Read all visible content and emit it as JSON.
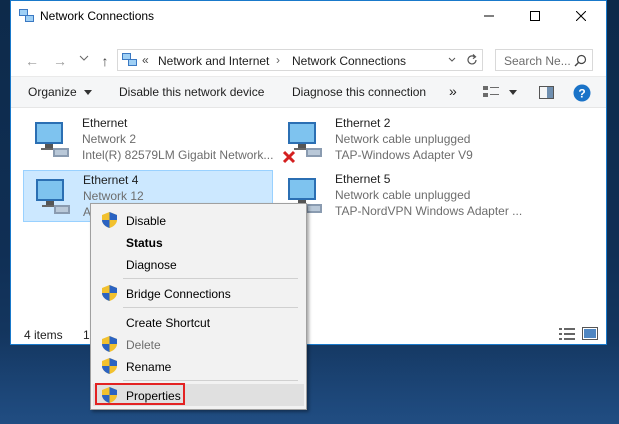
{
  "window": {
    "title": "Network Connections",
    "breadcrumb": [
      "Network and Internet",
      "Network Connections"
    ],
    "breadcrumb_prefix": "«",
    "search_placeholder": "Search Ne..."
  },
  "toolbar": {
    "organize": "Organize",
    "disable": "Disable this network device",
    "diagnose": "Diagnose this connection",
    "more": "»"
  },
  "adapters": [
    {
      "name": "Ethernet",
      "line2": "Network  2",
      "line3": "Intel(R) 82579LM Gigabit Network...",
      "error": false,
      "selected": false
    },
    {
      "name": "Ethernet 2",
      "line2": "Network cable unplugged",
      "line3": "TAP-Windows Adapter V9",
      "error": true,
      "selected": false
    },
    {
      "name": "Ethernet 4",
      "line2": "Network 12",
      "line3": "A",
      "error": false,
      "selected": true
    },
    {
      "name": "Ethernet 5",
      "line2": "Network cable unplugged",
      "line3": "TAP-NordVPN Windows Adapter ...",
      "error": false,
      "selected": false
    }
  ],
  "status": {
    "count": "4 items",
    "selected": "1"
  },
  "context_menu": {
    "disable": "Disable",
    "status": "Status",
    "diagnose": "Diagnose",
    "bridge": "Bridge Connections",
    "create_shortcut": "Create Shortcut",
    "delete": "Delete",
    "rename": "Rename",
    "properties": "Properties"
  },
  "colors": {
    "accent": "#1979ca",
    "selection": "#cce8ff",
    "highlight_border": "#e32222",
    "help": "#1a73c8"
  }
}
